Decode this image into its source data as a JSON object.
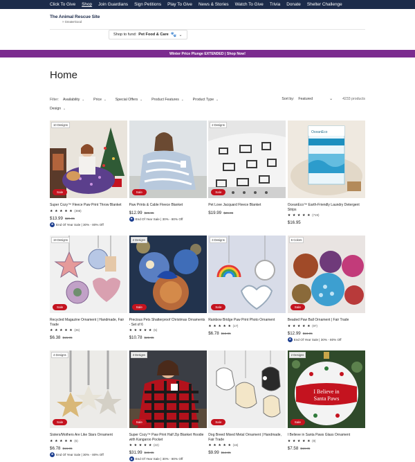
{
  "topnav": {
    "items": [
      "Click To Give",
      "Shop",
      "Join Guardians",
      "Sign Petitions",
      "Play To Give",
      "News & Stories",
      "Watch To Give",
      "Trivia",
      "Donate",
      "Shelter Challenge"
    ]
  },
  "logo": {
    "main": "The Animal Rescue Site",
    "sub": "× GreaterGood"
  },
  "fund": {
    "label": "Shop to fund:",
    "value": "Pet Food & Care"
  },
  "promo_banner": "Winter Price Plunge EXTENDED | Shop Now!",
  "page_title": "Home",
  "filters": {
    "label": "Filter:",
    "items": [
      "Availability",
      "Price",
      "Special Offers",
      "Product Features",
      "Product Type"
    ],
    "design": "Design",
    "sort_label": "Sort by:",
    "sort_value": "Featured",
    "product_count": "4233 products"
  },
  "colors": {
    "nav": "#1c2b4a",
    "promo": "#7b2b8f",
    "sale": "#c4131f",
    "badge": "#1c3e8f"
  },
  "products": [
    {
      "designs": "10 Designs",
      "sale": "Sale",
      "title": "Super Cozy™ Fleece Paw Print Throw Blanket",
      "stars": "★ ★ ★ ★ ★",
      "reviews": "(398)",
      "price": "$13.99",
      "was": "$26.95",
      "promo": "End Of Year Sale | 30% - 80% Off"
    },
    {
      "designs": "",
      "sale": "Sale",
      "title": "Paw Prints & Cable Fleece Blanket",
      "stars": "",
      "reviews": "",
      "price": "$12.99",
      "was": "$26.95",
      "promo": "End Of Year Sale | 30% - 80% Off"
    },
    {
      "designs": "2 Designs",
      "sale": "Sale",
      "title": "Pet Love Jacquard Fleece Blanket",
      "stars": "",
      "reviews": "",
      "price": "$19.99",
      "was": "$26.95",
      "promo": ""
    },
    {
      "designs": "",
      "sale": "",
      "title": "OceanEco™ Earth-Friendly Laundry Detergent Strips",
      "stars": "★ ★ ★ ★ ★",
      "reviews": "(719)",
      "price": "$16.95",
      "was": "",
      "promo": ""
    },
    {
      "designs": "19 Designs",
      "sale": "Sale",
      "title": "Recycled Magazine Ornament | Handmade, Fair Trade",
      "stars": "★ ★ ★ ★ ★",
      "reviews": "(26)",
      "price": "$6.38",
      "was": "$15.95",
      "promo": ""
    },
    {
      "designs": "2 Designs",
      "sale": "Sale",
      "title": "Precious Pets Shatterproof Christmas Ornaments - Set of 6",
      "stars": "★ ★ ★ ★ ★",
      "reviews": "(5)",
      "price": "$10.78",
      "was": "$26.95",
      "promo": ""
    },
    {
      "designs": "3 Designs",
      "sale": "Sale",
      "title": "Rainbow Bridge Paw Print Photo Ornament",
      "stars": "★ ★ ★ ★ ★",
      "reviews": "(17)",
      "price": "$6.78",
      "was": "$16.95",
      "promo": ""
    },
    {
      "designs": "6 Colors",
      "sale": "Sale",
      "title": "Beaded Paw Ball Ornament | Fair Trade",
      "stars": "★ ★ ★ ★ ★",
      "reviews": "(97)",
      "price": "$12.99",
      "was": "$18.95",
      "promo": "End Of Year Sale | 30% - 80% Off"
    },
    {
      "designs": "4 Designs",
      "sale": "Sale",
      "title": "Sisters/Mothers Are Like Stars Ornament",
      "stars": "★ ★ ★ ★ ★",
      "reviews": "(6)",
      "price": "$6.78",
      "was": "$16.95",
      "promo": "End Of Year Sale | 30% - 80% Off"
    },
    {
      "designs": "3 Designs",
      "sale": "Sale",
      "title": "Super Cozy™ Paw Print Half Zip Blanket Hoodie with Kangaroo Pocket",
      "stars": "★ ★ ★ ★ ★",
      "reviews": "(22)",
      "price": "$31.99",
      "was": "$49.95",
      "promo": "End Of Year Sale | 30% - 80% Off"
    },
    {
      "designs": "",
      "sale": "Sale",
      "title": "Dog Breed Mixed Metal Ornament | Handmade, Fair Trade",
      "stars": "★ ★ ★ ★ ★",
      "reviews": "(16)",
      "price": "$9.99",
      "was": "$14.95",
      "promo": ""
    },
    {
      "designs": "2 Designs",
      "sale": "Sale",
      "title": "I Believe in Santa Paws Glass Ornament",
      "stars": "★ ★ ★ ★ ★",
      "reviews": "(9)",
      "price": "$7.58",
      "was": "$18.95",
      "promo": ""
    }
  ]
}
